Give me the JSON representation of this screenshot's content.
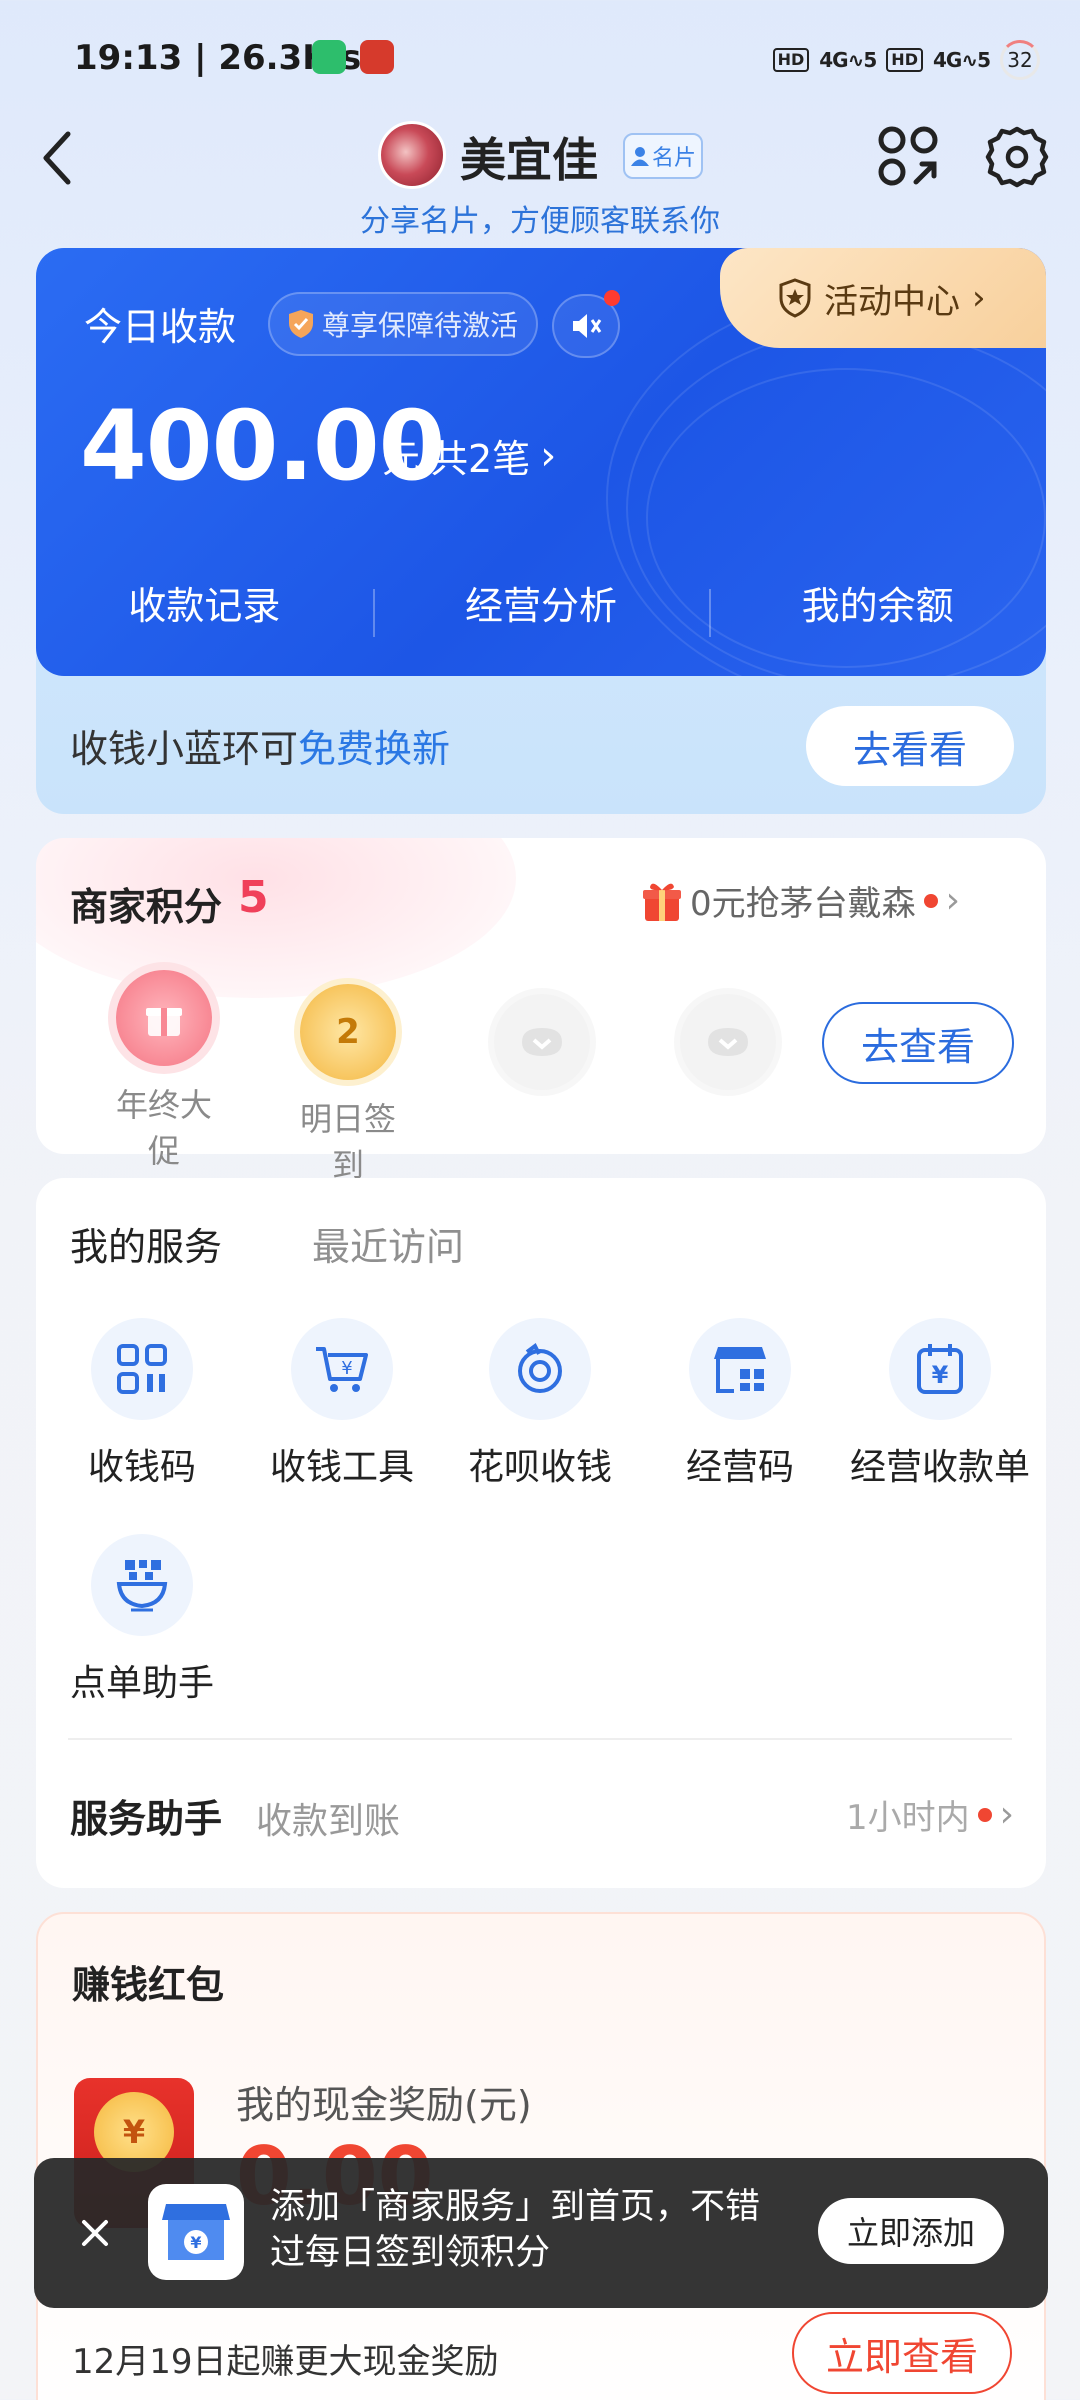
{
  "status_bar": {
    "time_speed": "19:13 | 26.3K/s",
    "hd1": "HD",
    "signal1": "4G",
    "signal1_level": "5",
    "hd2": "HD",
    "signal2": "4G",
    "signal2_level": "5",
    "battery": "32"
  },
  "header": {
    "store_name": "美宜佳",
    "card_badge": "名片",
    "share_hint": "分享名片，方便顾客联系你"
  },
  "collection": {
    "today_label": "今日收款",
    "guarantee": "尊享保障待激活",
    "activity_center": "活动中心",
    "amount": "400.00",
    "currency": "元",
    "count": "共2笔",
    "tabs": [
      "收款记录",
      "经营分析",
      "我的余额"
    ],
    "promo_prefix": "收钱小蓝环可",
    "promo_highlight": "免费换新",
    "promo_button": "去看看"
  },
  "points": {
    "title": "商家积分",
    "value": "5",
    "promo": "0元抢茅台戴森",
    "items": [
      {
        "label": "年终大促"
      },
      {
        "label": "明日签到",
        "coin_text": "2"
      }
    ],
    "check_button": "去查看"
  },
  "services": {
    "tab_active": "我的服务",
    "tab_inactive": "最近访问",
    "items": [
      {
        "label": "收钱码",
        "icon": "qr-code-icon"
      },
      {
        "label": "收钱工具",
        "icon": "cart-icon"
      },
      {
        "label": "花呗收钱",
        "icon": "huabei-icon"
      },
      {
        "label": "经营码",
        "icon": "store-code-icon"
      },
      {
        "label": "经营收款单",
        "icon": "calendar-yuan-icon"
      },
      {
        "label": "点单助手",
        "icon": "order-assistant-icon"
      }
    ],
    "assistant_title": "服务助手",
    "assistant_sub": "收款到账",
    "assistant_time": "1小时内"
  },
  "earn": {
    "title": "赚钱红包",
    "subtitle": "我的现金奖励(元)",
    "amount": "0.00",
    "packet_symbol": "¥",
    "bottom_text": "12月19日起赚更大现金奖励",
    "bottom_button": "立即查看"
  },
  "toast": {
    "text": "添加「商家服务」到首页，不错过每日签到领积分",
    "button": "立即添加"
  },
  "colors": {
    "brand_blue": "#1d56e6",
    "accent_red": "#f04632",
    "link_blue": "#2b6cde"
  }
}
